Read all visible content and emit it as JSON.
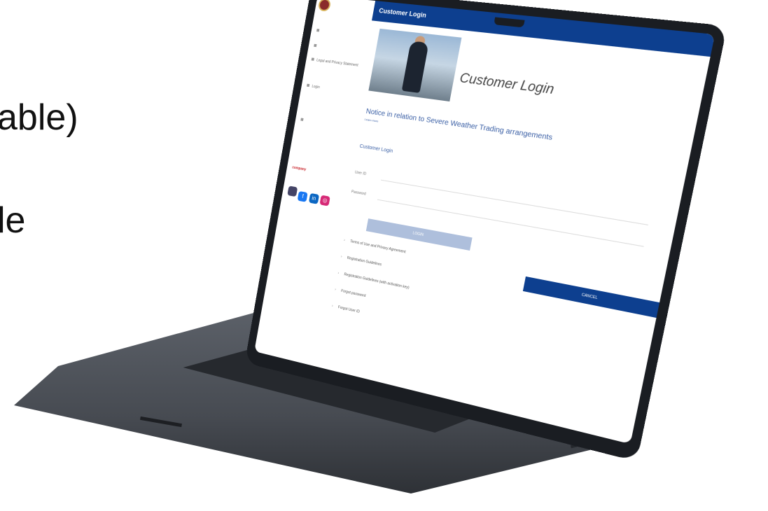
{
  "slide": {
    "line1": "able)",
    "line2": "le"
  },
  "app": {
    "logo_text": "",
    "header_title": "Customer Login",
    "page_title": "Customer Login"
  },
  "sidebar": {
    "items": [
      {
        "label": "",
        "icon": "square-icon"
      },
      {
        "label": "",
        "icon": "square-icon"
      },
      {
        "label": "Legal and Privacy Statement",
        "icon": "square-icon"
      },
      {
        "label": "Login",
        "icon": "square-icon"
      },
      {
        "label": "",
        "icon": "square-icon"
      }
    ],
    "brand": "company"
  },
  "notice": {
    "title": "Notice in relation to Severe Weather Trading arrangements",
    "link": "Learn more"
  },
  "login_section": {
    "title": "Customer Login",
    "user_id_label": "User ID",
    "password_label": "Password",
    "login_button": "LOGIN",
    "cancel_button": "CANCEL"
  },
  "links": [
    "Terms of Use and Privacy Agreement",
    "Registration Guidelines",
    "Registration Guidelines (with activation key)",
    "Forgot password",
    "Forgot User ID"
  ],
  "colors": {
    "header_blue": "#0d3f8f",
    "login_button": "#aebfdc",
    "laptop_body": "#4a4e55"
  }
}
